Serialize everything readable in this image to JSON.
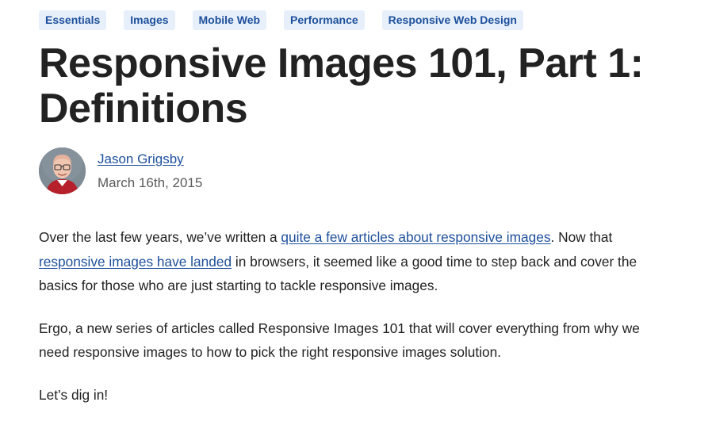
{
  "tags": [
    "Essentials",
    "Images",
    "Mobile Web",
    "Performance",
    "Responsive Web Design"
  ],
  "title": "Responsive Images 101, Part 1: Definitions",
  "author": {
    "name": "Jason Grigsby",
    "date": "March 16th, 2015"
  },
  "article": {
    "p1": {
      "text_a": "Over the last few years, we’ve written a ",
      "link_a": "quite a few articles about responsive images",
      "text_b": ". Now that ",
      "link_b": "responsive images have landed",
      "text_c": " in browsers, it seemed like a good time to step back and cover the basics for those who are just starting to tackle responsive images."
    },
    "p2": "Ergo, a new series of articles called Responsive Images 101 that will cover everything from why we need responsive images to how to pick the right responsive images solution.",
    "p3": "Let’s dig in!"
  },
  "colors": {
    "link": "#1d4f9c",
    "tag_bg": "#e7f0fa",
    "text": "#222222"
  }
}
